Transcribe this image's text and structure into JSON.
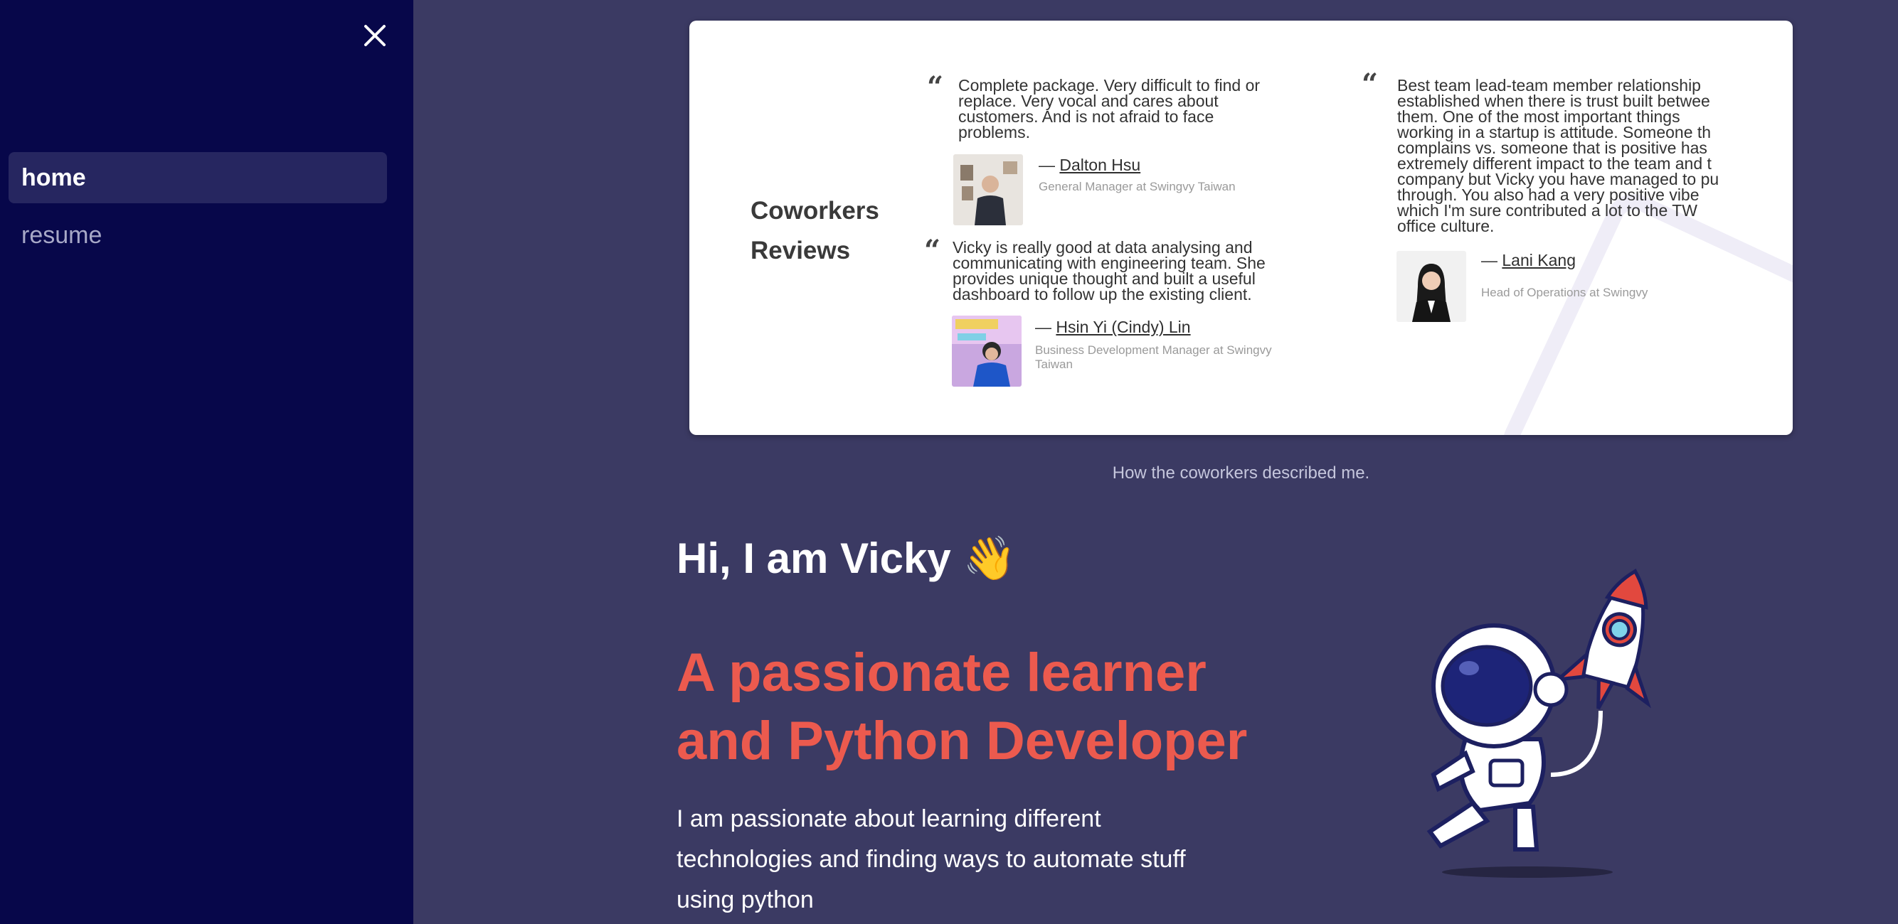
{
  "sidebar": {
    "close_icon": "close-icon",
    "items": [
      {
        "label": "home",
        "active": true
      },
      {
        "label": "resume",
        "active": false
      }
    ]
  },
  "reviews_card": {
    "title_line1": "Coworkers",
    "title_line2": "Reviews",
    "reviews": [
      {
        "quote_lines": [
          "Complete package. Very difficult to find or",
          "replace. Very vocal and cares about",
          "customers. And is not afraid to face",
          "problems."
        ],
        "name": "Dalton Hsu",
        "role_lines": [
          "General Manager at Swingvy Taiwan"
        ]
      },
      {
        "quote_lines": [
          "Vicky is really good at data analysing and",
          "communicating with engineering team. She",
          "provides unique thought and built a useful",
          "dashboard to follow up the existing client."
        ],
        "name": "Hsin Yi (Cindy) Lin",
        "role_lines": [
          "Business Development Manager at Swingvy",
          "Taiwan"
        ]
      },
      {
        "quote_lines": [
          "Best team lead-team member relationship",
          "established when there is trust built betwee",
          "them. One of the most important things",
          "working in a startup is attitude. Someone th",
          "complains vs. someone that is positive has",
          "extremely different impact to the team and t",
          "company but Vicky you have managed to pu",
          "through. You also had a very positive vibe",
          "which I'm sure contributed a lot to the TW",
          "office culture."
        ],
        "name": "Lani Kang",
        "role_lines": [
          "Head of Operations at Swingvy"
        ]
      }
    ],
    "dash": "—"
  },
  "caption": "How the coworkers described me.",
  "hero": {
    "greeting": "Hi, I am Vicky 👋",
    "headline_line1": "A passionate learner",
    "headline_line2": "and Python Developer",
    "intro_line1": "I am passionate about learning different",
    "intro_line2": "technologies and finding ways to automate stuff",
    "intro_line3": "using python"
  },
  "colors": {
    "sidebar_bg": "#07074a",
    "main_bg": "#3b3a63",
    "accent": "#ec5a4e"
  }
}
